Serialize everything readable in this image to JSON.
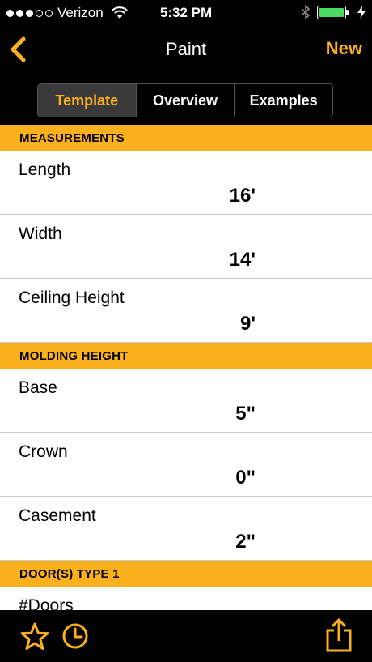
{
  "status_bar": {
    "carrier": "Verizon",
    "time": "5:32 PM",
    "signal_dots": [
      true,
      true,
      true,
      false,
      false
    ],
    "battery_level": 1.0,
    "icons": [
      "wifi-icon",
      "bluetooth-icon",
      "battery-icon",
      "charging-icon"
    ]
  },
  "nav": {
    "title": "Paint",
    "right_label": "New",
    "back_icon": "chevron-left-icon"
  },
  "segments": [
    {
      "label": "Template",
      "active": true
    },
    {
      "label": "Overview",
      "active": false
    },
    {
      "label": "Examples",
      "active": false
    }
  ],
  "sections": [
    {
      "header": "MEASUREMENTS",
      "rows": [
        {
          "label": "Length",
          "value": "16'"
        },
        {
          "label": "Width",
          "value": "14'"
        },
        {
          "label": "Ceiling Height",
          "value": "9'"
        }
      ]
    },
    {
      "header": "MOLDING HEIGHT",
      "rows": [
        {
          "label": "Base",
          "value": "5\""
        },
        {
          "label": "Crown",
          "value": "0\""
        },
        {
          "label": "Casement",
          "value": "2\""
        }
      ]
    },
    {
      "header": "DOOR(S) TYPE 1",
      "rows": [
        {
          "label": "#Doors",
          "value": ""
        }
      ]
    }
  ],
  "tab_bar": {
    "icons": [
      "star-icon",
      "clock-icon",
      "share-icon"
    ]
  },
  "colors": {
    "accent": "#fbb01e",
    "background": "#000000",
    "row_background": "#ffffff",
    "separator": "#c8c7cc",
    "battery": "#4cd964",
    "segment_active": "#3a3a3a"
  }
}
